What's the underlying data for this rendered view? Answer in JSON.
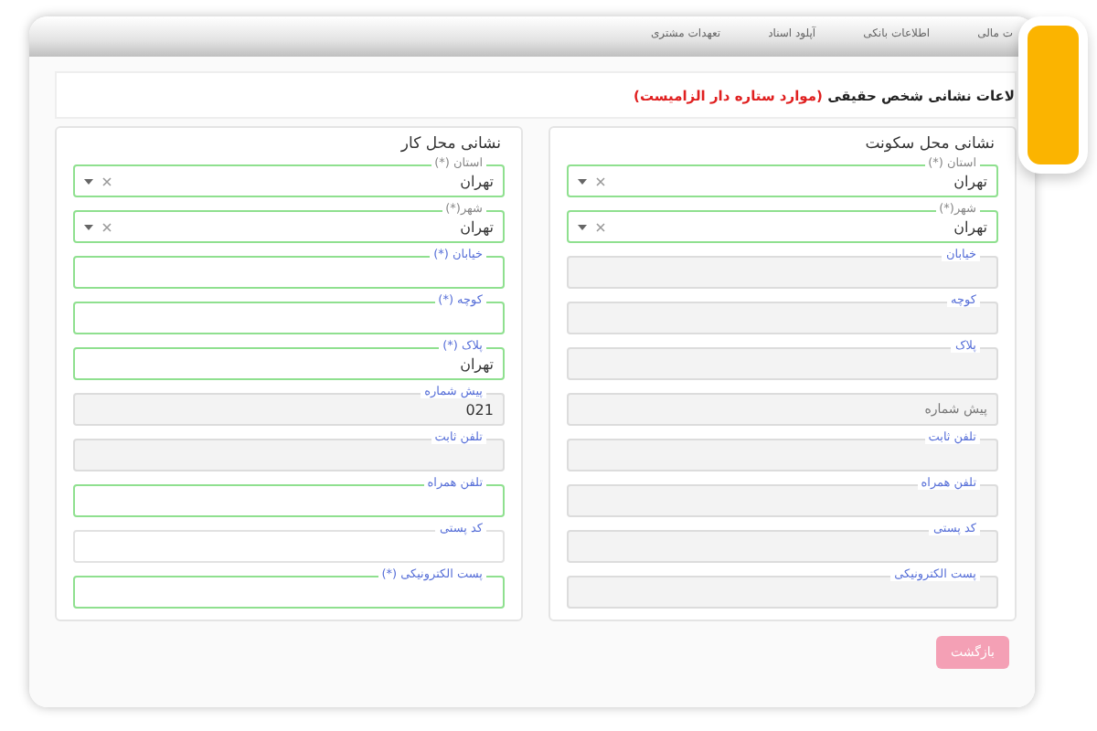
{
  "nav_tabs": [
    {
      "label": "ت مالی"
    },
    {
      "label": "اطلاعات بانکی"
    },
    {
      "label": "آپلود اسناد"
    },
    {
      "label": "تعهدات مشتری"
    }
  ],
  "heading": {
    "text": "لاعات نشانی شخص حقیقی",
    "note": "(موارد ستاره دار الزامیست)"
  },
  "panels": [
    {
      "title": "نشانی محل سکونت",
      "fields": [
        {
          "kind": "select",
          "label": "استان (*)",
          "value": "تهران",
          "valid": true,
          "disabled": false
        },
        {
          "kind": "select",
          "label": "شهر(*)",
          "value": "تهران",
          "valid": true,
          "disabled": false
        },
        {
          "kind": "text",
          "label": "خیابان",
          "valid": false,
          "disabled": true
        },
        {
          "kind": "text",
          "label": "کوچه",
          "valid": false,
          "disabled": true
        },
        {
          "kind": "text",
          "label": "پلاک",
          "valid": false,
          "disabled": true
        },
        {
          "kind": "text",
          "placeholder": "پیش شماره",
          "valid": false,
          "disabled": true
        },
        {
          "kind": "text",
          "label": "تلفن ثابت",
          "valid": false,
          "disabled": true
        },
        {
          "kind": "text",
          "label": "تلفن همراه",
          "valid": false,
          "disabled": true
        },
        {
          "kind": "text",
          "label": "کد پستی",
          "valid": false,
          "disabled": true
        },
        {
          "kind": "text",
          "label": "پست الکترونیکی",
          "valid": false,
          "disabled": true
        }
      ]
    },
    {
      "title": "نشانی محل کار",
      "fields": [
        {
          "kind": "select",
          "label": "استان (*)",
          "value": "تهران",
          "valid": true,
          "disabled": false
        },
        {
          "kind": "select",
          "label": "شهر(*)",
          "value": "تهران",
          "valid": true,
          "disabled": false
        },
        {
          "kind": "text",
          "label": "خیابان (*)",
          "valid": true,
          "disabled": false
        },
        {
          "kind": "text",
          "label": "کوچه (*)",
          "valid": true,
          "disabled": false
        },
        {
          "kind": "text",
          "label": "پلاک (*)",
          "value": "تهران",
          "valid": true,
          "disabled": false
        },
        {
          "kind": "text",
          "label": "پیش شماره",
          "value": "021",
          "valid": false,
          "disabled": true
        },
        {
          "kind": "text",
          "label": "تلفن ثابت",
          "valid": false,
          "disabled": true
        },
        {
          "kind": "text",
          "label": "تلفن همراه",
          "valid": true,
          "disabled": false
        },
        {
          "kind": "text",
          "label": "کد پستی",
          "valid": false,
          "disabled": false
        },
        {
          "kind": "text",
          "label": "پست الکترونیکی (*)",
          "valid": true,
          "disabled": false
        }
      ]
    }
  ],
  "back_button": "بازگشت"
}
